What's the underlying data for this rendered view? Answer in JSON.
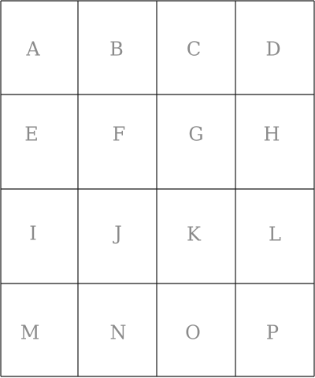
{
  "grid": {
    "rows": 4,
    "cols": 4,
    "line_color": "#1a1a1a",
    "label_color": "#8a8a8a",
    "cells": [
      [
        "A",
        "B",
        "C",
        "D"
      ],
      [
        "E",
        "F",
        "G",
        "H"
      ],
      [
        "I",
        "J",
        "K",
        "L"
      ],
      [
        "M",
        "N",
        "O",
        "P"
      ]
    ]
  }
}
